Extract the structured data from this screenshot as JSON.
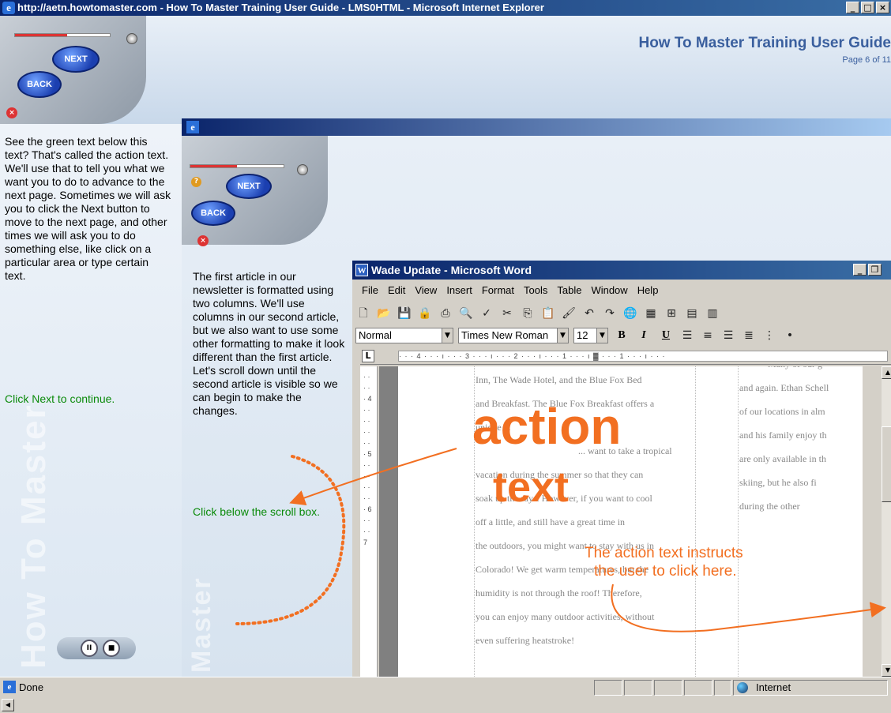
{
  "browser": {
    "title": "http://aetn.howtomaster.com - How To Master Training User Guide - LMS0HTML - Microsoft Internet Explorer",
    "buttons": [
      "_",
      "□",
      "×"
    ],
    "status_text": "Done",
    "zone_text": "Internet"
  },
  "header": {
    "guide_title": "How To Master Training User Guide",
    "page_indicator": "Page 6 of 11"
  },
  "nav": {
    "next_label": "NEXT",
    "back_label": "BACK",
    "progress_fraction": 0.55
  },
  "left_panel": {
    "instructions": "See the green text below this text? That's called the action text. We'll use that to tell you what we want you to do to advance to the next page. Sometimes we will ask you to click the Next button to move to the next page, and other times we will ask you to do something else, like click on a particular area or type certain text.",
    "action_text": "Click Next to continue.",
    "watermark": "How To Master"
  },
  "inner_nav": {
    "next_label": "NEXT",
    "back_label": "BACK",
    "progress_fraction": 0.5
  },
  "inner_panel": {
    "instructions": "The first article in our newsletter is formatted using two columns. We'll use columns in our second article, but we also want to use some other formatting to make it look different than the first article. Let's scroll down until the second article is visible so we can begin to make the changes.",
    "action_text": "Click below the scroll box.",
    "watermark": "Master"
  },
  "word": {
    "title": "Wade Update - Microsoft Word",
    "menus": [
      "File",
      "Edit",
      "View",
      "Insert",
      "Format",
      "Tools",
      "Table",
      "Window",
      "Help"
    ],
    "style": "Normal",
    "font": "Times New Roman",
    "size": "12",
    "left_column_lines": [
      "Inn, The Wade Hotel, and the Blue Fox Bed",
      "and Breakfast. The Blue Fox Breakfast offers a",
      "unique ...",
      "... want to take a tropical",
      "vacation during the summer so that they can",
      "soak up the rays. However, if you want to cool",
      "off a little, and still have a great time in",
      "the outdoors, you might want to stay with us in",
      "Colorado! We get warm temperatures, but the",
      "humidity is not through the roof! Therefore,",
      "you can enjoy many outdoor activities, without",
      "even suffering heatstroke!"
    ],
    "right_column_lines": [
      "Many of our g",
      "and again. Ethan Schell",
      "of our locations in alm",
      "and his family enjoy th",
      "are only available in th",
      "skiing, but he also fi",
      "during the other",
      "",
      "",
      "",
      "",
      ""
    ]
  },
  "callouts": {
    "action_line1": "action",
    "action_line2": "text",
    "instruction_line1": "The action text instructs",
    "instruction_line2": "the user to click here."
  },
  "colors": {
    "title_bar": "#0a246a",
    "action_green": "#0a8a0a",
    "callout_orange": "#f26f21",
    "guide_blue": "#3a5f9e"
  }
}
